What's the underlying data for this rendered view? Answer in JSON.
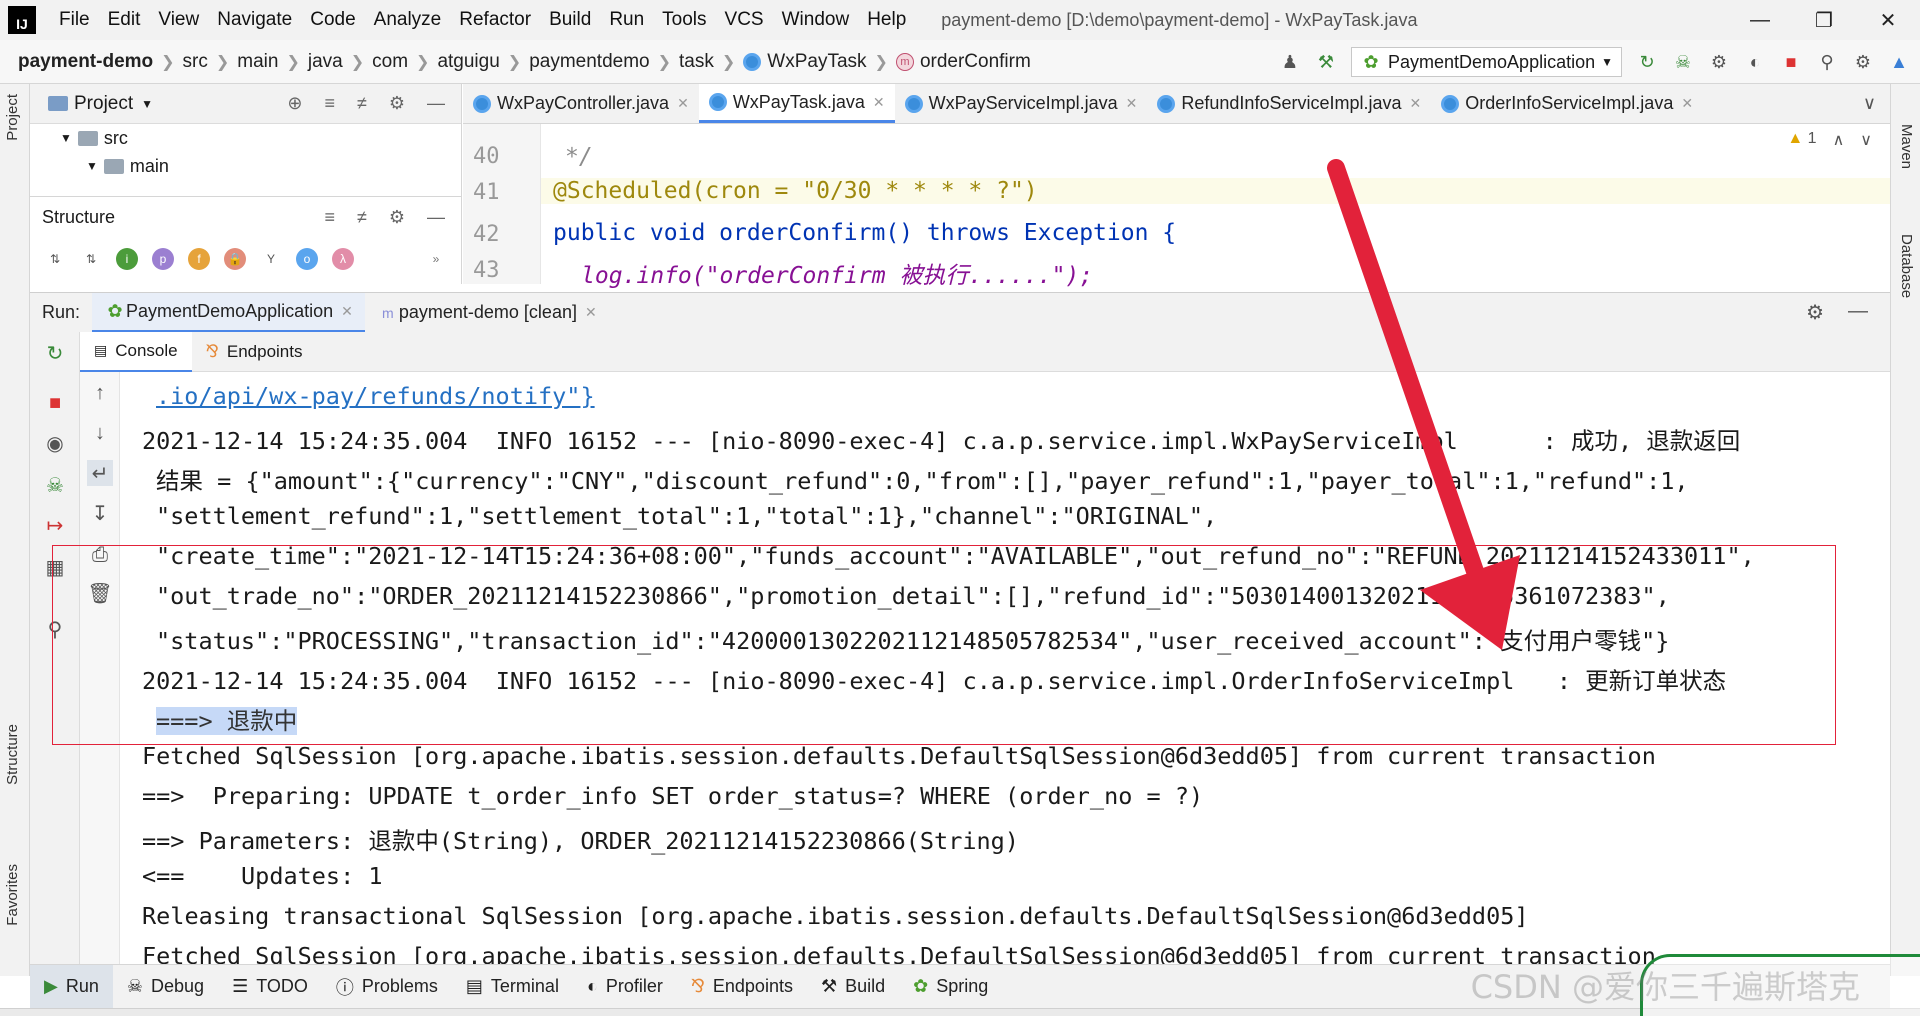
{
  "menubar": {
    "logo": "IJ",
    "items": [
      "File",
      "Edit",
      "View",
      "Navigate",
      "Code",
      "Analyze",
      "Refactor",
      "Build",
      "Run",
      "Tools",
      "VCS",
      "Window",
      "Help"
    ],
    "title": "payment-demo [D:\\demo\\payment-demo] - WxPayTask.java"
  },
  "navbar": {
    "crumbs": [
      "payment-demo",
      "src",
      "main",
      "java",
      "com",
      "atguigu",
      "paymentdemo",
      "task",
      "WxPayTask",
      "orderConfirm"
    ],
    "run_config": "PaymentDemoApplication"
  },
  "project_panel": {
    "title": "Project",
    "tree": [
      "src",
      "main"
    ]
  },
  "structure_panel": {
    "title": "Structure"
  },
  "editor_tabs": [
    "WxPayController.java",
    "WxPayTask.java",
    "WxPayServiceImpl.java",
    "RefundInfoServiceImpl.java",
    "OrderInfoServiceImpl.java"
  ],
  "editor": {
    "line_numbers": [
      "40",
      "41",
      "42",
      "43"
    ],
    "lines": [
      "*/",
      "@Scheduled(cron = \"0/30 * * * * ?\")",
      "public void orderConfirm() throws Exception {",
      "log.info(\"orderConfirm 被执行......\");"
    ],
    "warning_count": "1"
  },
  "run_window": {
    "label": "Run:",
    "tabs": [
      "PaymentDemoApplication",
      "payment-demo [clean]"
    ],
    "subtabs": [
      "Console",
      "Endpoints"
    ]
  },
  "console": {
    "lines": [
      ".io/api/wx-pay/refunds/notify\"}",
      "2021-12-14 15:24:35.004  INFO 16152 --- [nio-8090-exec-4] c.a.p.service.impl.WxPayServiceImpl      : 成功, 退款返回",
      "结果 = {\"amount\":{\"currency\":\"CNY\",\"discount_refund\":0,\"from\":[],\"payer_refund\":1,\"payer_total\":1,\"refund\":1,",
      "\"settlement_refund\":1,\"settlement_total\":1,\"total\":1},\"channel\":\"ORIGINAL\",",
      "\"create_time\":\"2021-12-14T15:24:36+08:00\",\"funds_account\":\"AVAILABLE\",\"out_refund_no\":\"REFUND_20211214152433011\",",
      "\"out_trade_no\":\"ORDER_20211214152230866\",\"promotion_detail\":[],\"refund_id\":\"50301400132021121415361072383\",",
      "\"status\":\"PROCESSING\",\"transaction_id\":\"4200001302202112148505782534\",\"user_received_account\":\"支付用户零钱\"}",
      "2021-12-14 15:24:35.004  INFO 16152 --- [nio-8090-exec-4] c.a.p.service.impl.OrderInfoServiceImpl   : 更新订单状态",
      "===> 退款中",
      "Fetched SqlSession [org.apache.ibatis.session.defaults.DefaultSqlSession@6d3edd05] from current transaction",
      "==>  Preparing: UPDATE t_order_info SET order_status=? WHERE (order_no = ?)",
      "==> Parameters: 退款中(String), ORDER_20211214152230866(String)",
      "<==    Updates: 1",
      "Releasing transactional SqlSession [org.apache.ibatis.session.defaults.DefaultSqlSession@6d3edd05]",
      "Fetched SqlSession [org.apache.ibatis.session.defaults.DefaultSqlSession@6d3edd05] from current transaction"
    ]
  },
  "bottom_tabs": [
    "Run",
    "Debug",
    "TODO",
    "Problems",
    "Terminal",
    "Profiler",
    "Endpoints",
    "Build",
    "Spring"
  ],
  "left_vtabs": [
    "Project",
    "Structure",
    "Favorites"
  ],
  "right_vtabs": [
    "Maven",
    "Database"
  ],
  "watermark": "CSDN @爱你三千遍斯塔克",
  "colors": {
    "accent": "#4a86e8",
    "highlight_box": "#e2223a",
    "arrow": "#e2223a",
    "info": "#23803b",
    "logger_class": "#1e87a6"
  }
}
